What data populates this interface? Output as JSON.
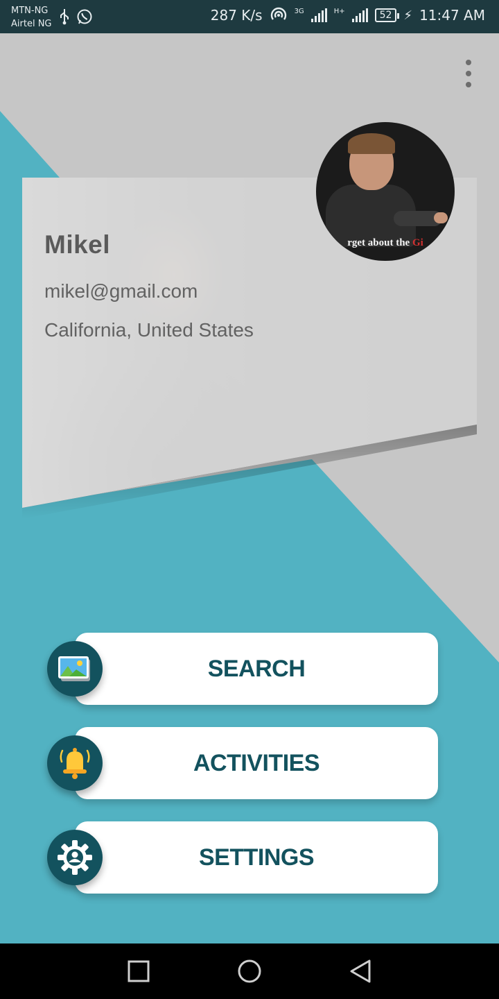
{
  "status_bar": {
    "carrier_1": "MTN-NG",
    "carrier_2": "Airtel NG",
    "network_speed": "287 K/s",
    "network_type_1": "3G",
    "network_type_2": "H+",
    "battery": "52",
    "time": "11:47 AM"
  },
  "profile": {
    "name": "Mikel",
    "email": "mikel@gmail.com",
    "location": "California, United States",
    "avatar_caption_prefix": "rget about the ",
    "avatar_caption_highlight": "Gi"
  },
  "menu": {
    "items": [
      {
        "label": "SEARCH",
        "icon": "picture-icon"
      },
      {
        "label": "ACTIVITIES",
        "icon": "bell-icon"
      },
      {
        "label": "SETTINGS",
        "icon": "gear-icon"
      }
    ]
  },
  "colors": {
    "teal": "#52b2c2",
    "dark_teal": "#13525e",
    "grey_background": "#c6c6c6",
    "status_bar": "#1e3a40"
  },
  "nav_bar": {
    "buttons": [
      "recent-apps",
      "home",
      "back"
    ]
  }
}
